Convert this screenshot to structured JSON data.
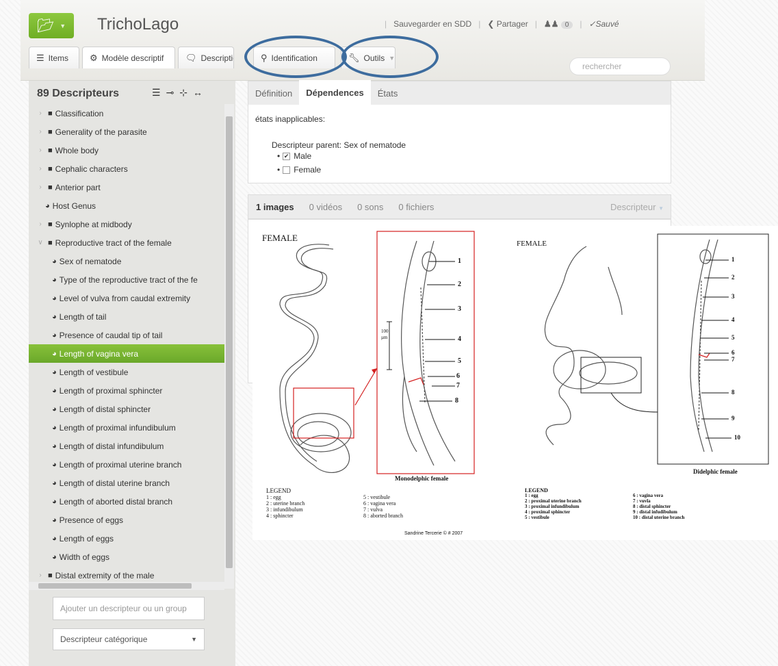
{
  "app": {
    "title": "TrichoLago"
  },
  "top_actions": {
    "save_sdd": "Sauvegarder en SDD",
    "share": "Partager",
    "users_count": "0",
    "saved": "Sauvé"
  },
  "tabs": [
    {
      "label": "Items",
      "icon": "list-icon"
    },
    {
      "label": "Modèle descriptif",
      "icon": "gears-icon"
    },
    {
      "label": "Descriptio",
      "icon": "comment-icon"
    },
    {
      "label": "Identification",
      "icon": "search-icon"
    },
    {
      "label": "Outils",
      "icon": "wrench-icon"
    }
  ],
  "search": {
    "placeholder": "rechercher"
  },
  "sidebar": {
    "heading": "89 Descripteurs",
    "items": [
      {
        "label": "Classification",
        "type": "group"
      },
      {
        "label": "Generality of the parasite",
        "type": "group"
      },
      {
        "label": "Whole body",
        "type": "group"
      },
      {
        "label": "Cephalic characters",
        "type": "group"
      },
      {
        "label": "Anterior part",
        "type": "group"
      },
      {
        "label": "Host Genus",
        "type": "descriptor"
      },
      {
        "label": "Synlophe at midbody",
        "type": "group"
      },
      {
        "label": "Reproductive tract of the female",
        "type": "group-open"
      },
      {
        "label": "Sex of nematode",
        "type": "child"
      },
      {
        "label": "Type of the reproductive tract of the fe",
        "type": "child"
      },
      {
        "label": "Level of vulva from caudal extremity",
        "type": "child"
      },
      {
        "label": "Length of tail",
        "type": "child"
      },
      {
        "label": "Presence of caudal tip of tail",
        "type": "child"
      },
      {
        "label": "Length of vagina vera",
        "type": "child-selected"
      },
      {
        "label": "Length of vestibule",
        "type": "child"
      },
      {
        "label": "Length of proximal sphincter",
        "type": "child"
      },
      {
        "label": "Length of distal sphincter",
        "type": "child"
      },
      {
        "label": "Length of proximal infundibulum",
        "type": "child"
      },
      {
        "label": "Length of distal infundibulum",
        "type": "child"
      },
      {
        "label": "Length of proximal uterine branch",
        "type": "child"
      },
      {
        "label": "Length of distal uterine branch",
        "type": "child"
      },
      {
        "label": "Length of aborted distal branch",
        "type": "child"
      },
      {
        "label": "Presence of eggs",
        "type": "child"
      },
      {
        "label": "Length of eggs",
        "type": "child"
      },
      {
        "label": "Width of eggs",
        "type": "child"
      },
      {
        "label": "Distal extremity of the male",
        "type": "group"
      }
    ],
    "add_placeholder": "Ajouter un descripteur ou un group",
    "type_select": "Descripteur catégorique"
  },
  "detail": {
    "tabs": [
      "Définition",
      "Dépendences",
      "États"
    ],
    "active_tab": "Dépendences",
    "inapplicable_label": "états inapplicables:",
    "parent_label": "Descripteur parent: Sex of nematode",
    "states": [
      {
        "label": "Male",
        "checked": true
      },
      {
        "label": "Female",
        "checked": false
      }
    ]
  },
  "media": {
    "tabs": [
      "1 images",
      "0 vidéos",
      "0 sons",
      "0 fichiers"
    ],
    "active_tab": "1 images",
    "dropdown": "Descripteur"
  },
  "figure": {
    "left_title": "FEMALE",
    "right_title": "FEMALE",
    "scale_label": "100 µm",
    "left_numbers": [
      "1",
      "2",
      "3",
      "4",
      "5",
      "6",
      "7",
      "8"
    ],
    "right_numbers": [
      "1",
      "2",
      "3",
      "4",
      "5",
      "6",
      "7",
      "8",
      "9",
      "10"
    ],
    "left_caption": "Monodelphic female",
    "right_caption": "Didelphic female",
    "legend_title": "LEGEND",
    "left_legend_a": [
      "1 : egg",
      "2 : uterine branch",
      "3 : infundibulum",
      "4 : sphincter"
    ],
    "left_legend_b": [
      "5 : vestibule",
      "6 : vagina vera",
      "7 : vulva",
      "8 : aborted branch"
    ],
    "right_legend_a": [
      "1 : egg",
      "2 : proximal uterine branch",
      "3 : proximal infundibulum",
      "4 : proximal sphincter",
      "5 : vestibule"
    ],
    "right_legend_b": [
      "6 : vagina vera",
      "7 : vuvla",
      "8 : distal sphincter",
      "9 : distal infudibulum",
      "10 : distal uterine branch"
    ],
    "credit": "Sandrine Tercerie © # 2007"
  },
  "colors": {
    "accent": "#7ab735",
    "ellipse": "#3d6c9e",
    "figure_red": "#d42020"
  }
}
